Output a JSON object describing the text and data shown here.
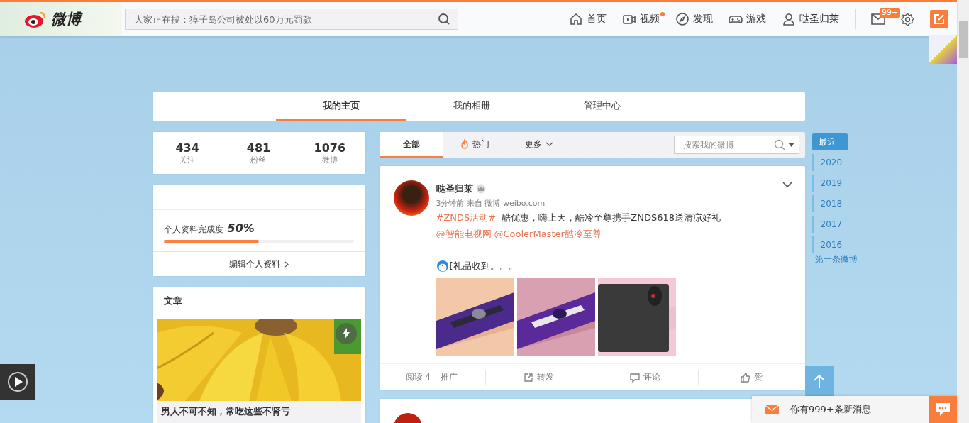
{
  "header": {
    "logo_text": "微博",
    "search_placeholder": "大家正在搜：獐子岛公司被处以60万元罚款",
    "nav": [
      {
        "kind": "home",
        "label": "首页",
        "dot": false
      },
      {
        "kind": "video",
        "label": "视频",
        "dot": true
      },
      {
        "kind": "discover",
        "label": "发现",
        "dot": false
      },
      {
        "kind": "game",
        "label": "游戏",
        "dot": false
      },
      {
        "kind": "user",
        "label": "哒圣归莱",
        "dot": false
      }
    ],
    "message_badge": "99+"
  },
  "tabs": [
    {
      "label": "我的主页",
      "selected": true
    },
    {
      "label": "我的相册",
      "selected": false
    },
    {
      "label": "管理中心",
      "selected": false
    }
  ],
  "stats": [
    {
      "value": "434",
      "label": "关注"
    },
    {
      "value": "481",
      "label": "粉丝"
    },
    {
      "value": "1076",
      "label": "微博"
    }
  ],
  "profile": {
    "completion_label": "个人资料完成度",
    "completion_value": "50%",
    "level": 0.5,
    "edit_link": "编辑个人资料"
  },
  "articles": {
    "title": "文章",
    "items": [
      {
        "kind": "picture",
        "title": "男人不可不知，常吃这些不肾亏"
      }
    ]
  },
  "feed_tabs": [
    {
      "label": "全部",
      "kind": "plain",
      "selected": true
    },
    {
      "label": "热门",
      "kind": "hot",
      "selected": false
    },
    {
      "label": "更多",
      "kind": "more",
      "selected": false
    }
  ],
  "feed_search": {
    "placeholder": "搜索我的微博"
  },
  "post": {
    "author": "哒圣归莱",
    "meta": "3分钟前 来自 微博 weibo.com",
    "lines": [
      [
        {
          "text": "#ZNDS活动#",
          "link": true
        },
        {
          "text": " 酷优惠，嗨上天，酷冷至尊携手ZNDS618送清凉好礼",
          "link": false
        }
      ],
      [
        {
          "text": "@智能电视网",
          "link": true
        },
        {
          "text": "@CoolerMaster酷冷至尊",
          "link": true
        }
      ]
    ],
    "note": "[礼品收到。。。",
    "photos": [
      {
        "kind": "picture"
      },
      {
        "kind": "picture"
      },
      {
        "kind": "picture"
      }
    ],
    "reads": "阅读 4",
    "promote": "推广",
    "actions": [
      {
        "kind": "forward",
        "label": "转发"
      },
      {
        "kind": "comment",
        "label": "评论"
      },
      {
        "kind": "like",
        "label": "赞"
      }
    ]
  },
  "timeline": {
    "items": [
      {
        "label": "最近",
        "selected": true
      },
      {
        "label": "2020",
        "selected": false
      },
      {
        "label": "2019",
        "selected": false
      },
      {
        "label": "2018",
        "selected": false
      },
      {
        "label": "2017",
        "selected": false
      },
      {
        "label": "2016",
        "selected": false
      }
    ],
    "first": "第一条微博"
  },
  "notification": {
    "text": "你有999+条新消息"
  }
}
